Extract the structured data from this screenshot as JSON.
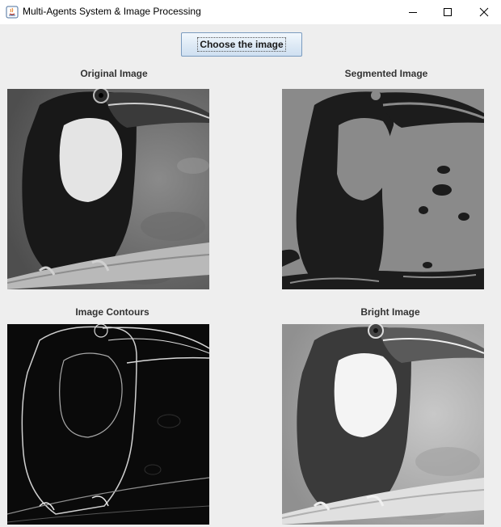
{
  "window": {
    "title": "Multi-Agents System & Image Processing"
  },
  "toolbar": {
    "choose_label": "Choose the image"
  },
  "panels": [
    {
      "label": "Original Image",
      "variant": "original"
    },
    {
      "label": "Segmented Image",
      "variant": "segmented"
    },
    {
      "label": "Image Contours",
      "variant": "contours"
    },
    {
      "label": "Bright Image",
      "variant": "bright"
    }
  ],
  "icons": {
    "app": "java-app-icon",
    "minimize": "minimize-icon",
    "maximize": "maximize-icon",
    "close": "close-icon"
  }
}
